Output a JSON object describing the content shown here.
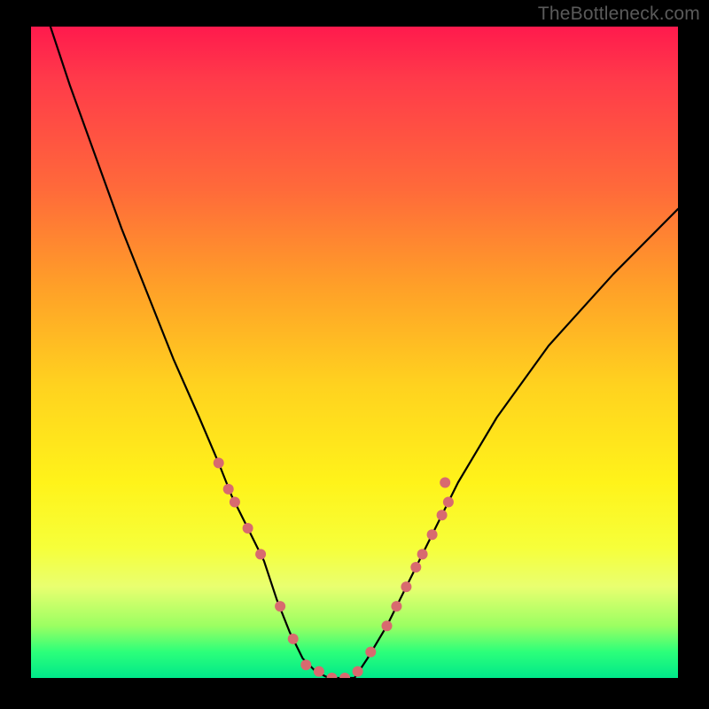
{
  "watermark": "TheBottleneck.com",
  "chart_data": {
    "type": "line",
    "title": "",
    "xlabel": "",
    "ylabel": "",
    "xlim": [
      0,
      100
    ],
    "ylim": [
      0,
      100
    ],
    "grid": false,
    "legend": false,
    "curve": {
      "x": [
        3,
        6,
        10,
        14,
        18,
        22,
        26,
        29,
        31,
        33.5,
        36,
        38,
        40,
        42,
        44,
        46,
        48,
        50,
        52,
        55,
        58,
        62,
        66,
        72,
        80,
        90,
        100
      ],
      "y": [
        100,
        91,
        80,
        69,
        59,
        49,
        40,
        33,
        28,
        23,
        18,
        12,
        7,
        3,
        1,
        0,
        0,
        0,
        3,
        8,
        14,
        22,
        30,
        40,
        51,
        62,
        72
      ],
      "stroke": "#000000",
      "stroke_width": 2.2
    },
    "markers": {
      "shape": "circle",
      "fill": "#d86a6f",
      "radius": 6,
      "points": [
        {
          "x": 29.0,
          "y": 33
        },
        {
          "x": 30.5,
          "y": 29
        },
        {
          "x": 31.5,
          "y": 27
        },
        {
          "x": 33.5,
          "y": 23
        },
        {
          "x": 35.5,
          "y": 19
        },
        {
          "x": 38.5,
          "y": 11
        },
        {
          "x": 40.5,
          "y": 6
        },
        {
          "x": 42.5,
          "y": 2
        },
        {
          "x": 44.5,
          "y": 1
        },
        {
          "x": 46.5,
          "y": 0
        },
        {
          "x": 48.5,
          "y": 0
        },
        {
          "x": 50.5,
          "y": 1
        },
        {
          "x": 52.5,
          "y": 4
        },
        {
          "x": 55.0,
          "y": 8
        },
        {
          "x": 56.5,
          "y": 11
        },
        {
          "x": 58.0,
          "y": 14
        },
        {
          "x": 59.5,
          "y": 17
        },
        {
          "x": 60.5,
          "y": 19
        },
        {
          "x": 62.0,
          "y": 22
        },
        {
          "x": 63.5,
          "y": 25
        },
        {
          "x": 64.5,
          "y": 27
        },
        {
          "x": 64.0,
          "y": 30
        }
      ]
    }
  }
}
